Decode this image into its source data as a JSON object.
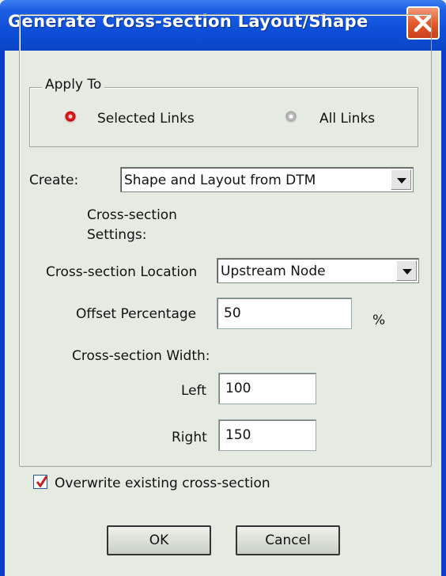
{
  "window": {
    "title": "Generate Cross-section Layout/Shape"
  },
  "apply_to": {
    "label": "Apply To",
    "options": [
      {
        "label": "Selected Links",
        "selected": true
      },
      {
        "label": "All Links",
        "selected": false
      }
    ]
  },
  "create": {
    "label": "Create:",
    "value": "Shape and Layout from DTM"
  },
  "settings": {
    "heading_line1": "Cross-section",
    "heading_line2": "Settings:",
    "location": {
      "label": "Cross-section Location",
      "value": "Upstream Node"
    },
    "offset": {
      "label": "Offset Percentage",
      "value": "50",
      "unit": "%"
    },
    "width": {
      "label": "Cross-section Width:",
      "left": {
        "label": "Left",
        "value": "100"
      },
      "right": {
        "label": "Right",
        "value": "150"
      }
    }
  },
  "overwrite": {
    "label": "Overwrite existing cross-section",
    "checked": true
  },
  "buttons": {
    "ok": "OK",
    "cancel": "Cancel"
  },
  "colors": {
    "titlebar": "#0e4fd8",
    "close": "#e35b2f",
    "background": "#e6ebe2"
  }
}
